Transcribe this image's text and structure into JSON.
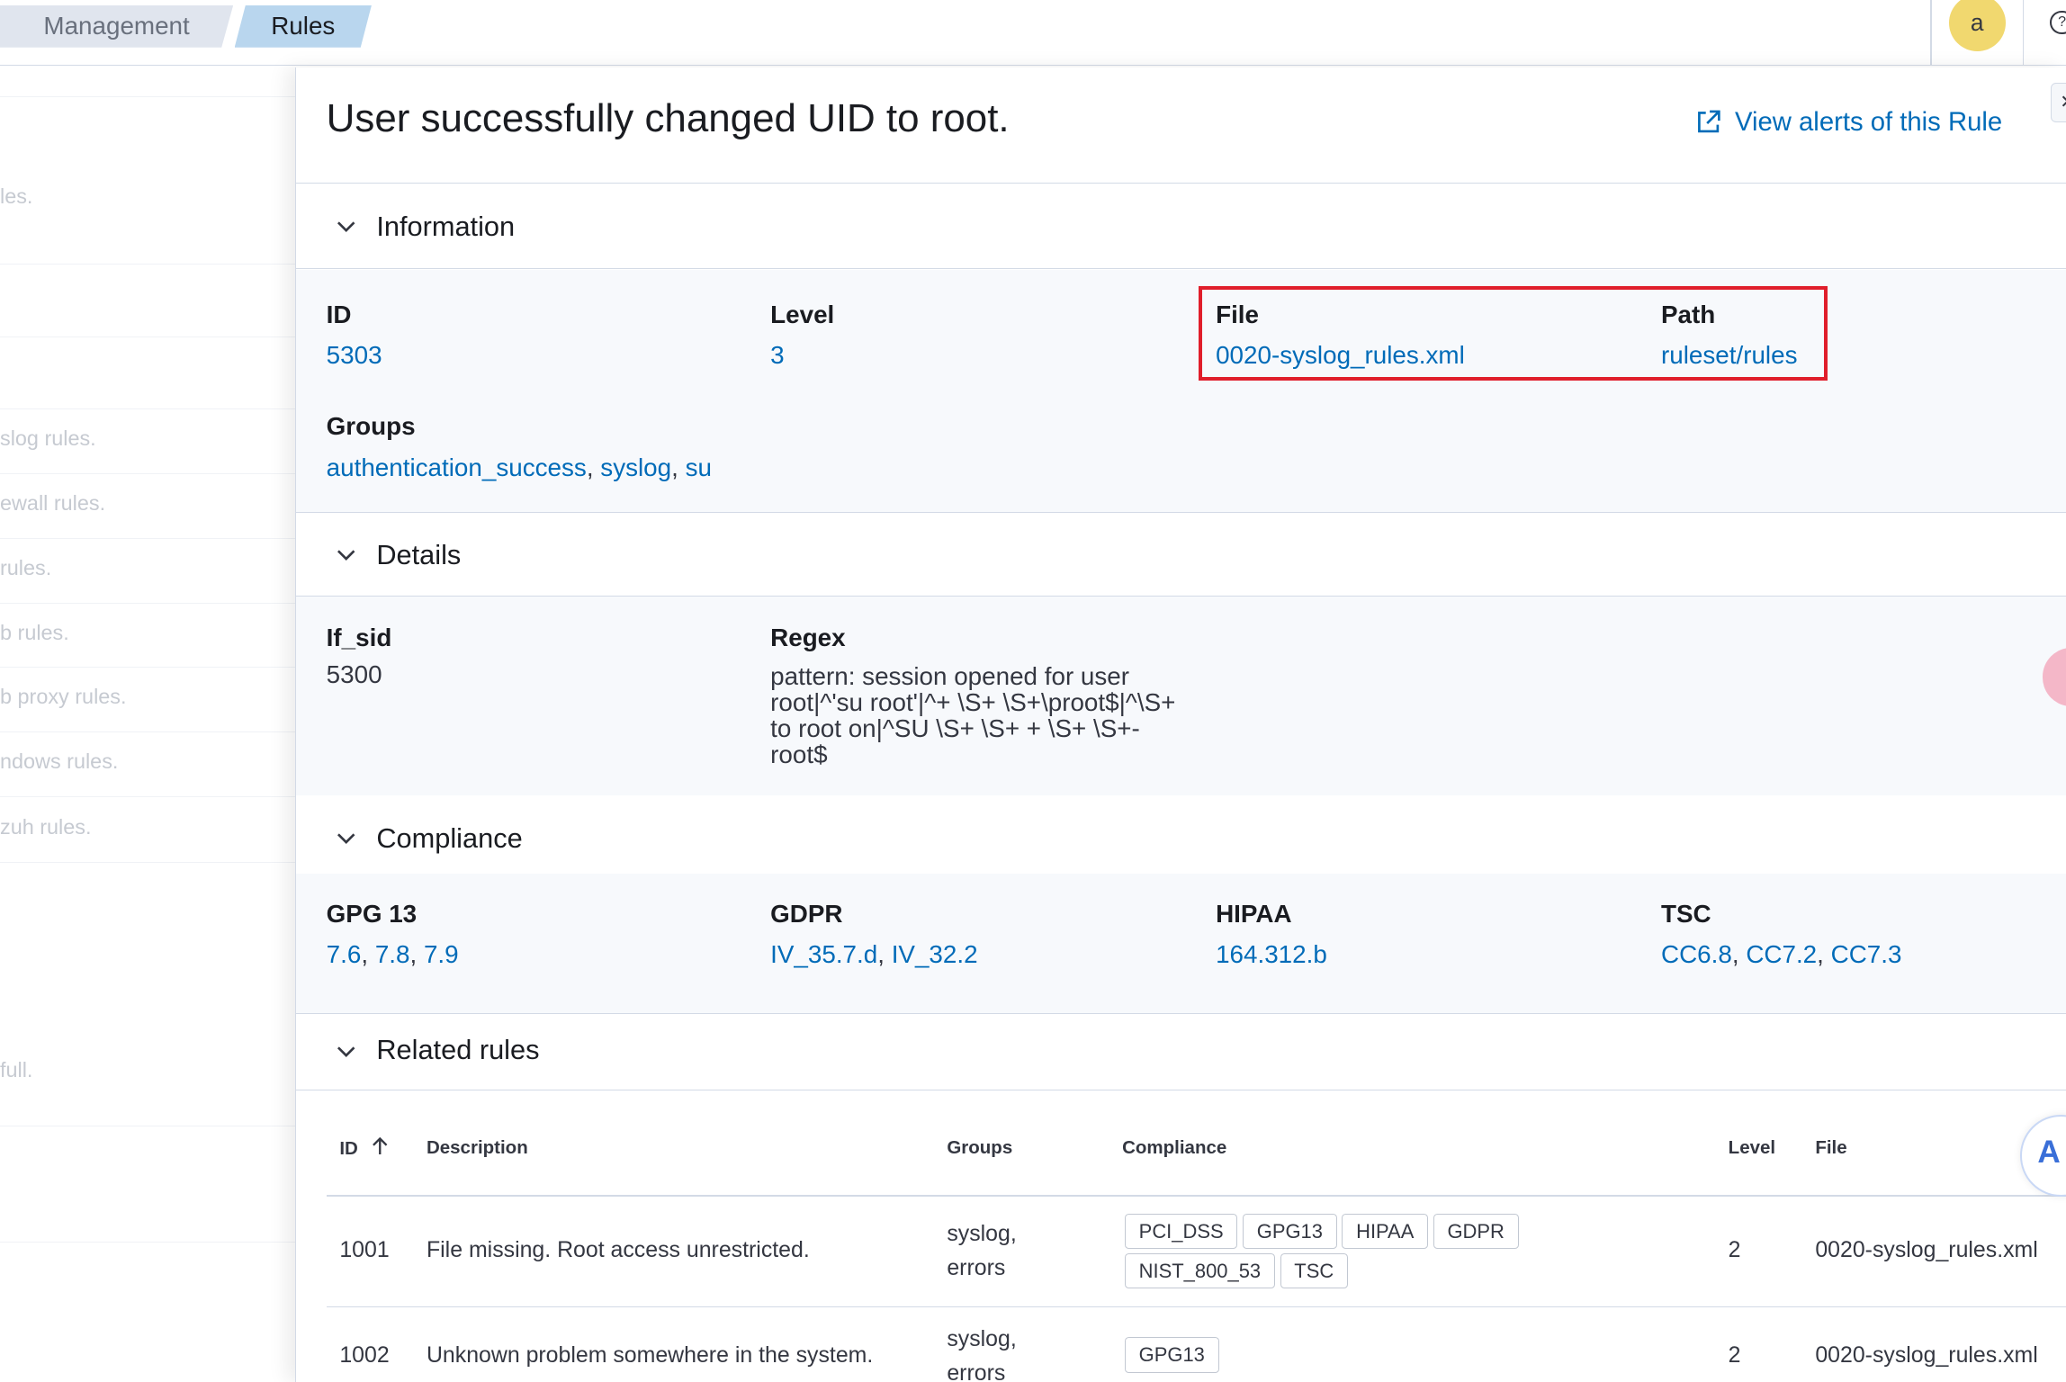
{
  "breadcrumbs": {
    "management": "Management",
    "rules": "Rules"
  },
  "user": {
    "avatar_letter": "a"
  },
  "background_list": [
    {
      "text": "les."
    },
    {
      "text": ""
    },
    {
      "text": ""
    },
    {
      "text": "slog rules."
    },
    {
      "text": "ewall rules."
    },
    {
      "text": " rules."
    },
    {
      "text": "b rules."
    },
    {
      "text": "b proxy rules."
    },
    {
      "text": "ndows rules."
    },
    {
      "text": "zuh rules."
    },
    {
      "text": "full."
    }
  ],
  "flyout": {
    "title": "User successfully changed UID to root.",
    "view_alerts_label": "View alerts of this Rule",
    "information": {
      "section_title": "Information",
      "id_label": "ID",
      "id_value": "5303",
      "level_label": "Level",
      "level_value": "3",
      "file_label": "File",
      "file_value": "0020-syslog_rules.xml",
      "path_label": "Path",
      "path_value": "ruleset/rules",
      "groups_label": "Groups",
      "groups": [
        "authentication_success",
        "syslog",
        "su"
      ]
    },
    "details": {
      "section_title": "Details",
      "if_sid_label": "If_sid",
      "if_sid_value": "5300",
      "regex_label": "Regex",
      "regex_value": "pattern: session opened for user root|^'su root'|^+ \\S+ \\S+\\proot$|^\\S+ to root on|^SU \\S+ \\S+ + \\S+ \\S+-root$"
    },
    "compliance": {
      "section_title": "Compliance",
      "gpg13_label": "GPG 13",
      "gpg13": [
        "7.6",
        "7.8",
        "7.9"
      ],
      "gdpr_label": "GDPR",
      "gdpr": [
        "IV_35.7.d",
        "IV_32.2"
      ],
      "hipaa_label": "HIPAA",
      "hipaa": [
        "164.312.b"
      ],
      "tsc_label": "TSC",
      "tsc": [
        "CC6.8",
        "CC7.2",
        "CC7.3"
      ]
    },
    "related_rules": {
      "section_title": "Related rules",
      "columns": {
        "id": "ID",
        "description": "Description",
        "groups": "Groups",
        "compliance": "Compliance",
        "level": "Level",
        "file": "File"
      },
      "rows": [
        {
          "id": "1001",
          "description": "File missing. Root access unrestricted.",
          "groups_line1": "syslog,",
          "groups_line2": "errors",
          "compliance": [
            "PCI_DSS",
            "GPG13",
            "HIPAA",
            "GDPR",
            "NIST_800_53",
            "TSC"
          ],
          "level": "2",
          "file": "0020-syslog_rules.xml"
        },
        {
          "id": "1002",
          "description": "Unknown problem somewhere in the system.",
          "groups_line1": "syslog,",
          "groups_line2": "errors",
          "compliance": [
            "GPG13"
          ],
          "level": "2",
          "file": "0020-syslog_rules.xml"
        }
      ]
    }
  }
}
